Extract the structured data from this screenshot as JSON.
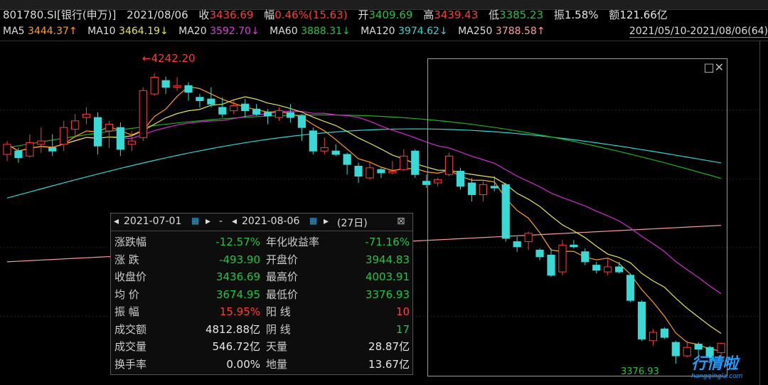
{
  "header": {
    "code_name": "801780.SI[银行(申万)]",
    "date": "2021/08/06",
    "close_label": "收",
    "close": "3436.69",
    "chg_label": "幅",
    "chg": "0.46%(15.63)",
    "open_label": "开",
    "open": "3409.69",
    "high_label": "高",
    "high": "3439.43",
    "low_label": "低",
    "low": "3385.23",
    "amp_label": "振",
    "amp": "1.58%",
    "amt_label": "额",
    "amt": "121.66亿"
  },
  "ma": {
    "ma5_label": "MA5",
    "ma5": "3444.37↑",
    "ma10_label": "MA10",
    "ma10": "3464.19↓",
    "ma20_label": "MA20",
    "ma20": "3592.70↓",
    "ma60_label": "MA60",
    "ma60": "3888.31↓",
    "ma120_label": "MA120",
    "ma120": "3974.62↓",
    "ma250_label": "MA250",
    "ma250": "3788.58↑",
    "range": "2021/05/10-2021/08/06(64)"
  },
  "colors": {
    "up": "#ff3c3c",
    "down": "#39d9d5",
    "ma5": "#ff9f1a",
    "ma10": "#e6e64a",
    "ma20": "#d22bd2",
    "ma60": "#1fb01f",
    "ma120": "#2fd6d6",
    "ma250": "#ff9b9b"
  },
  "panel": {
    "start_date": "2021-07-01",
    "end_date": "2021-08-06",
    "dash": "-",
    "days": "(27日)",
    "rows": [
      {
        "k1": "涨跌幅",
        "v1": "-12.57%",
        "c1": "dn",
        "k2": "年化收益率",
        "v2": "-71.16%",
        "c2": "dn"
      },
      {
        "k1": "涨  跌",
        "v1": "-493.90",
        "c1": "dn",
        "k2": "开盘价",
        "v2": "3944.83",
        "c2": "dn"
      },
      {
        "k1": "收盘价",
        "v1": "3436.69",
        "c1": "dn",
        "k2": "最高价",
        "v2": "4003.91",
        "c2": "dn"
      },
      {
        "k1": "均  价",
        "v1": "3674.95",
        "c1": "dn",
        "k2": "最低价",
        "v2": "3376.93",
        "c2": "dn"
      },
      {
        "k1": "振  幅",
        "v1": "15.95%",
        "c1": "up",
        "k2": "阳  线",
        "v2": "10",
        "c2": "up"
      },
      {
        "k1": "成交额",
        "v1": "4812.88亿",
        "c1": "wht",
        "k2": "阴  线",
        "v2": "17",
        "c2": "dn"
      },
      {
        "k1": "成交量",
        "v1": "546.72亿",
        "c1": "wht",
        "k2": "天量",
        "v2": "28.87亿",
        "c2": "wht"
      },
      {
        "k1": "换手率",
        "v1": "0.00%",
        "c1": "wht",
        "k2": "地量",
        "v2": "13.67亿",
        "c2": "wht"
      }
    ]
  },
  "annotations": {
    "max": "←4242.20",
    "min": "3376.93"
  },
  "watermark": {
    "main": "行情啦",
    "sub": "hangqingla.com"
  },
  "chart_data": {
    "type": "candlestick",
    "title": "801780.SI[银行(申万)]",
    "x_range": [
      "2021/05/10",
      "2021/08/06"
    ],
    "y_range": [
      3330,
      4320
    ],
    "max_value": 4242.2,
    "min_value": 3376.93,
    "candles": [
      {
        "o": 4000,
        "c": 4030,
        "h": 4040,
        "l": 3980
      },
      {
        "o": 4010,
        "c": 3990,
        "h": 4020,
        "l": 3975
      },
      {
        "o": 3995,
        "c": 4035,
        "h": 4060,
        "l": 3990
      },
      {
        "o": 4030,
        "c": 4040,
        "h": 4080,
        "l": 4005
      },
      {
        "o": 4020,
        "c": 4010,
        "h": 4060,
        "l": 3995
      },
      {
        "o": 4030,
        "c": 4080,
        "h": 4100,
        "l": 4010
      },
      {
        "o": 4075,
        "c": 4100,
        "h": 4120,
        "l": 4050
      },
      {
        "o": 4110,
        "c": 4120,
        "h": 4140,
        "l": 4090
      },
      {
        "o": 4110,
        "c": 4025,
        "h": 4125,
        "l": 4000
      },
      {
        "o": 4070,
        "c": 4090,
        "h": 4100,
        "l": 4020
      },
      {
        "o": 4080,
        "c": 4015,
        "h": 4095,
        "l": 3995
      },
      {
        "o": 4030,
        "c": 4040,
        "h": 4070,
        "l": 4010
      },
      {
        "o": 4050,
        "c": 4190,
        "h": 4200,
        "l": 4040
      },
      {
        "o": 4180,
        "c": 4230,
        "h": 4242.2,
        "l": 4175
      },
      {
        "o": 4220,
        "c": 4200,
        "h": 4232,
        "l": 4180
      },
      {
        "o": 4200,
        "c": 4205,
        "h": 4230,
        "l": 4190
      },
      {
        "o": 4205,
        "c": 4185,
        "h": 4215,
        "l": 4160
      },
      {
        "o": 4170,
        "c": 4160,
        "h": 4180,
        "l": 4140
      },
      {
        "o": 4165,
        "c": 4150,
        "h": 4200,
        "l": 4140
      },
      {
        "o": 4140,
        "c": 4120,
        "h": 4170,
        "l": 4110
      },
      {
        "o": 4130,
        "c": 4145,
        "h": 4160,
        "l": 4120
      },
      {
        "o": 4150,
        "c": 4130,
        "h": 4165,
        "l": 4110
      },
      {
        "o": 4135,
        "c": 4120,
        "h": 4150,
        "l": 4115
      },
      {
        "o": 4125,
        "c": 4115,
        "h": 4135,
        "l": 4090
      },
      {
        "o": 4110,
        "c": 4130,
        "h": 4140,
        "l": 4100
      },
      {
        "o": 4125,
        "c": 4110,
        "h": 4150,
        "l": 4095
      },
      {
        "o": 4115,
        "c": 4080,
        "h": 4120,
        "l": 4040
      },
      {
        "o": 4070,
        "c": 4010,
        "h": 4080,
        "l": 4000
      },
      {
        "o": 4010,
        "c": 4020,
        "h": 4050,
        "l": 4000
      },
      {
        "o": 4010,
        "c": 4000,
        "h": 4030,
        "l": 3995
      },
      {
        "o": 4000,
        "c": 3970,
        "h": 4005,
        "l": 3940
      },
      {
        "o": 3965,
        "c": 3935,
        "h": 3975,
        "l": 3915
      },
      {
        "o": 3930,
        "c": 3960,
        "h": 3980,
        "l": 3925
      },
      {
        "o": 3955,
        "c": 3945,
        "h": 3960,
        "l": 3930
      },
      {
        "o": 3945,
        "c": 3950,
        "h": 3980,
        "l": 3940
      },
      {
        "o": 3955,
        "c": 3995,
        "h": 4015,
        "l": 3950
      },
      {
        "o": 4010,
        "c": 3940,
        "h": 4015,
        "l": 3930
      },
      {
        "o": 3920,
        "c": 3910,
        "h": 3940,
        "l": 3900
      },
      {
        "o": 3915,
        "c": 3925,
        "h": 3930,
        "l": 3905
      },
      {
        "o": 3940,
        "c": 3995,
        "h": 4005,
        "l": 3935
      },
      {
        "o": 3950,
        "c": 3905,
        "h": 3960,
        "l": 3895
      },
      {
        "o": 3915,
        "c": 3880,
        "h": 3930,
        "l": 3860
      },
      {
        "o": 3880,
        "c": 3910,
        "h": 3920,
        "l": 3860
      },
      {
        "o": 3905,
        "c": 3900,
        "h": 3935,
        "l": 3890
      },
      {
        "o": 3910,
        "c": 3750,
        "h": 3915,
        "l": 3740
      },
      {
        "o": 3740,
        "c": 3725,
        "h": 3755,
        "l": 3710
      },
      {
        "o": 3740,
        "c": 3765,
        "h": 3770,
        "l": 3715
      },
      {
        "o": 3715,
        "c": 3695,
        "h": 3720,
        "l": 3685
      },
      {
        "o": 3700,
        "c": 3640,
        "h": 3720,
        "l": 3635
      },
      {
        "o": 3650,
        "c": 3730,
        "h": 3745,
        "l": 3640
      },
      {
        "o": 3730,
        "c": 3725,
        "h": 3745,
        "l": 3720
      },
      {
        "o": 3710,
        "c": 3680,
        "h": 3720,
        "l": 3670
      },
      {
        "o": 3670,
        "c": 3655,
        "h": 3680,
        "l": 3645
      },
      {
        "o": 3650,
        "c": 3665,
        "h": 3690,
        "l": 3640
      },
      {
        "o": 3665,
        "c": 3650,
        "h": 3680,
        "l": 3645
      },
      {
        "o": 3640,
        "c": 3565,
        "h": 3645,
        "l": 3560
      },
      {
        "o": 3560,
        "c": 3450,
        "h": 3565,
        "l": 3445
      },
      {
        "o": 3445,
        "c": 3470,
        "h": 3480,
        "l": 3430
      },
      {
        "o": 3480,
        "c": 3455,
        "h": 3485,
        "l": 3450
      },
      {
        "o": 3440,
        "c": 3400,
        "h": 3445,
        "l": 3376.93
      },
      {
        "o": 3400,
        "c": 3425,
        "h": 3445,
        "l": 3395
      },
      {
        "o": 3435,
        "c": 3420,
        "h": 3440,
        "l": 3390
      },
      {
        "o": 3425,
        "c": 3395,
        "h": 3430,
        "l": 3385
      },
      {
        "o": 3409.69,
        "c": 3436.69,
        "h": 3439.43,
        "l": 3385.23
      }
    ],
    "ma_series": [
      {
        "name": "MA5"
      },
      {
        "name": "MA10"
      },
      {
        "name": "MA20"
      },
      {
        "name": "MA60"
      },
      {
        "name": "MA120"
      },
      {
        "name": "MA250"
      }
    ]
  }
}
